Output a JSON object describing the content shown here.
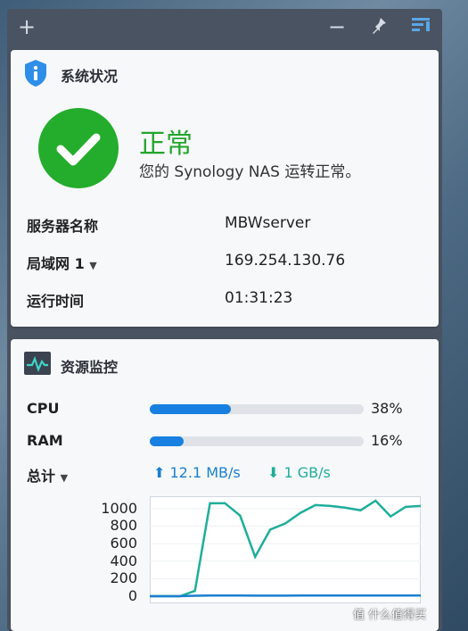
{
  "toolbar": {
    "add_icon": "plus-icon",
    "minimize_icon": "minus-icon",
    "pin_icon": "pin-icon",
    "layout_icon": "layout-icon"
  },
  "system_status": {
    "title": "系统状况",
    "status": "正常",
    "message": "您的 Synology NAS 运转正常。",
    "rows": [
      {
        "label": "服务器名称",
        "value": "MBWserver"
      },
      {
        "label": "局域网 1",
        "value": "169.254.130.76"
      },
      {
        "label": "运行时间",
        "value": "01:31:23"
      }
    ]
  },
  "resource_monitor": {
    "title": "资源监控",
    "cpu": {
      "label": "CPU",
      "percent_text": "38%",
      "percent": 38
    },
    "ram": {
      "label": "RAM",
      "percent_text": "16%",
      "percent": 16
    },
    "total_label": "总计",
    "upload": "12.1 MB/s",
    "download": "1 GB/s"
  },
  "chart_data": {
    "type": "line",
    "ylim": [
      0,
      1100
    ],
    "yticks": [
      "1000",
      "800",
      "600",
      "400",
      "200",
      "0"
    ],
    "series": [
      {
        "color": "#1fae9a",
        "values": [
          0,
          0,
          0,
          60,
          1060,
          1060,
          920,
          450,
          760,
          830,
          950,
          1040,
          1030,
          1010,
          980,
          1090,
          910,
          1020,
          1030
        ]
      },
      {
        "color": "#1a7fd0",
        "values": [
          0,
          0,
          0,
          5,
          8,
          8,
          8,
          6,
          6,
          7,
          8,
          8,
          8,
          8,
          8,
          8,
          8,
          8,
          8
        ]
      }
    ],
    "grid": true
  },
  "watermark": "值 什么值得买"
}
